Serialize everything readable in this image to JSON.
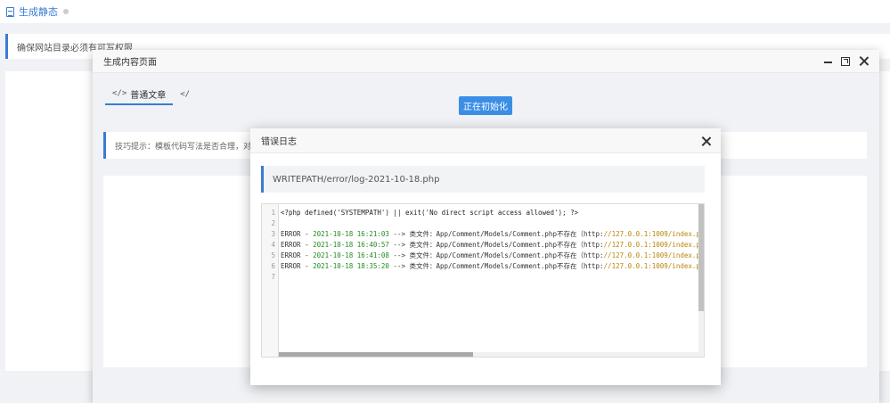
{
  "page": {
    "title": "生成静态",
    "alert": "确保网站目录必须有可写权限"
  },
  "main_modal": {
    "title": "生成内容页面",
    "tabs": [
      {
        "label": "普通文章"
      },
      {
        "label": ""
      }
    ],
    "init_button": "正在初始化",
    "tip": "技巧提示：模板代码写法是否合理，对生成"
  },
  "error_modal": {
    "title": "错误日志",
    "path": "WRITEPATH/error/log-2021-10-18.php",
    "lines": [
      {
        "n": "1",
        "text": "<?php defined('SYSTEMPATH') || exit('No direct script access allowed'); ?>"
      },
      {
        "n": "2",
        "text": ""
      },
      {
        "n": "3",
        "prefix": "ERROR - ",
        "date": "2021-10-18",
        "time": "16:21:03",
        "msg": " --> 类文件：App/Comment/Models/Comment.php不存在（http:",
        "url": "//127.0.0.1:1009/index.p"
      },
      {
        "n": "4",
        "prefix": "ERROR - ",
        "date": "2021-10-18",
        "time": "16:40:57",
        "msg": " --> 类文件：App/Comment/Models/Comment.php不存在（http:",
        "url": "//127.0.0.1:1009/index.p"
      },
      {
        "n": "5",
        "prefix": "ERROR - ",
        "date": "2021-10-18",
        "time": "16:41:08",
        "msg": " --> 类文件：App/Comment/Models/Comment.php不存在（http:",
        "url": "//127.0.0.1:1009/index.p"
      },
      {
        "n": "6",
        "prefix": "ERROR - ",
        "date": "2021-10-18",
        "time": "18:35:20",
        "msg": " --> 类文件：App/Comment/Models/Comment.php不存在（http:",
        "url": "//127.0.0.1:1009/index.p"
      },
      {
        "n": "7",
        "text": ""
      }
    ]
  },
  "colors": {
    "accent": "#3a7bd5",
    "button": "#3a8ee6"
  }
}
